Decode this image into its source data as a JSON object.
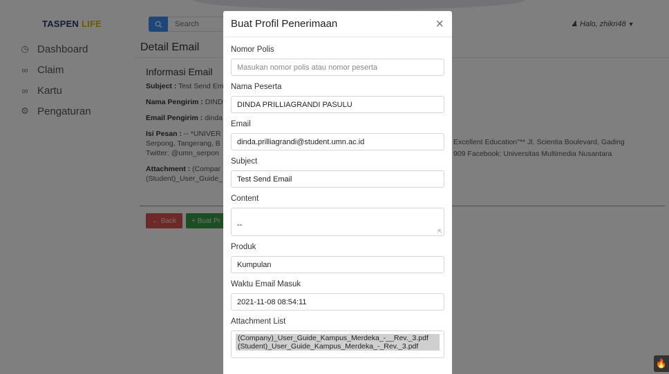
{
  "brand": {
    "name_part1": "TASPEN",
    "name_part2": "LIFE"
  },
  "search": {
    "placeholder": "Search"
  },
  "user": {
    "greeting": "Halo, zhikri48"
  },
  "sidebar": {
    "items": [
      {
        "label": "Dashboard",
        "icon": "dashboard-icon"
      },
      {
        "label": "Claim",
        "icon": "users-icon"
      },
      {
        "label": "Kartu",
        "icon": "users-icon"
      },
      {
        "label": "Pengaturan",
        "icon": "gear-icon"
      }
    ]
  },
  "main": {
    "title": "Detail Email",
    "section_title": "Informasi Email",
    "subject_label": "Subject :",
    "subject_value": "Test Send Em",
    "sender_name_label": "Nama Pengirim :",
    "sender_name_value": "DIND",
    "sender_email_label": "Email Pengirim :",
    "sender_email_value": "dinda",
    "message_label": "Isi Pesan :",
    "message_line1": "-- *UNIVER",
    "message_line2": "Serpong, Tangerang, B",
    "message_line3": "Twitter: @umn_serpon",
    "message_right_line1": "Excellent Education\"** Jl. Scientia Boulevard, Gading",
    "message_right_line2": "909  Facebook: Universitas Multimedia Nusantara",
    "attachment_label": "Attachment :",
    "attachment_line1": "(Compar",
    "attachment_line2": "(Student)_User_Guide_",
    "back_label": "← Back",
    "create_label": "+ Buat Pr"
  },
  "modal": {
    "title": "Buat Profil Penerimaan",
    "close": "×",
    "fields": {
      "nomor_polis": {
        "label": "Nomor Polis",
        "placeholder": "Masukan nomor polis atau nomor peserta"
      },
      "nama_peserta": {
        "label": "Nama Peserta",
        "value": "DINDA PRILLIAGRANDI PASULU"
      },
      "email": {
        "label": "Email",
        "value": "dinda.prilliagrandi@student.umn.ac.id"
      },
      "subject": {
        "label": "Subject",
        "value": "Test Send Email"
      },
      "content": {
        "label": "Content",
        "value": "--"
      },
      "produk": {
        "label": "Produk",
        "value": "Kumpulan"
      },
      "waktu": {
        "label": "Waktu Email Masuk",
        "value": "2021-11-08 08:54:11"
      },
      "attachments": {
        "label": "Attachment List",
        "items": [
          "(Company)_User_Guide_Kampus_Merdeka_-__Rev._3.pdf",
          "(Student)_User_Guide_Kampus_Merdeka_-_Rev._3.pdf"
        ]
      }
    }
  },
  "colors": {
    "primary": "#3b8ff0",
    "danger": "#d9534f",
    "success": "#3a9b4a",
    "brand": "#1f3b6f",
    "brand_accent": "#e0b400"
  }
}
